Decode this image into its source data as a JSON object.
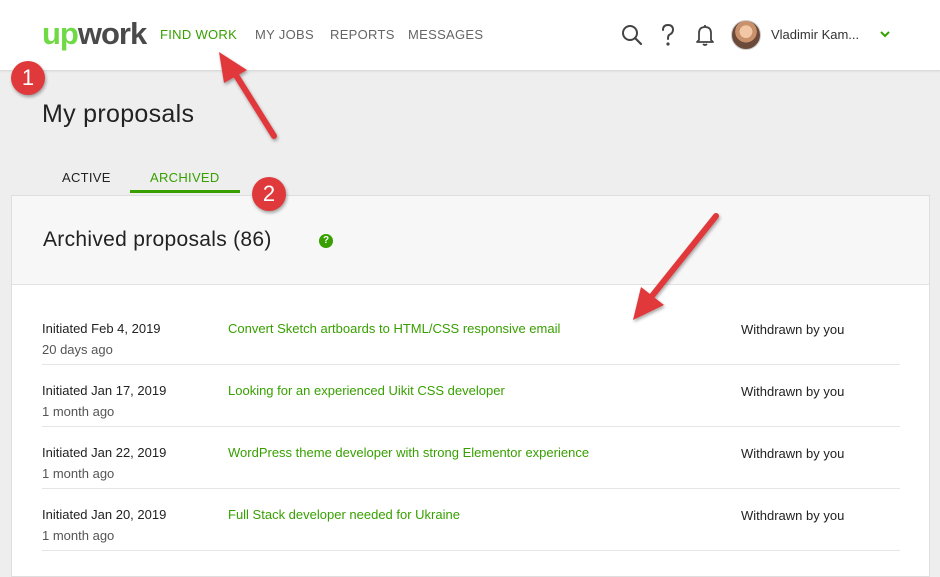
{
  "header": {
    "logo_up": "up",
    "logo_work": "work",
    "nav": [
      {
        "label": "FIND WORK",
        "active": true
      },
      {
        "label": "MY JOBS",
        "active": false
      },
      {
        "label": "REPORTS",
        "active": false
      },
      {
        "label": "MESSAGES",
        "active": false
      }
    ],
    "icons": [
      "search-icon",
      "help-icon",
      "bell-icon"
    ],
    "username": "Vladimir Kam..."
  },
  "page": {
    "title": "My proposals",
    "tabs": [
      {
        "label": "ACTIVE",
        "active": false
      },
      {
        "label": "ARCHIVED",
        "active": true
      }
    ]
  },
  "panel": {
    "title": "Archived proposals (86)",
    "help_glyph": "?",
    "rows": [
      {
        "initiated": "Initiated Feb 4, 2019",
        "ago": "20 days ago",
        "job": "Convert Sketch artboards to HTML/CSS responsive email",
        "status": "Withdrawn by you"
      },
      {
        "initiated": "Initiated Jan 17, 2019",
        "ago": "1 month ago",
        "job": "Looking for an experienced Uikit CSS developer",
        "status": "Withdrawn by you"
      },
      {
        "initiated": "Initiated Jan 22, 2019",
        "ago": "1 month ago",
        "job": "WordPress theme developer with strong Elementor experience",
        "status": "Withdrawn by you"
      },
      {
        "initiated": "Initiated Jan 20, 2019",
        "ago": "1 month ago",
        "job": "Full Stack developer needed for Ukraine",
        "status": "Withdrawn by you"
      }
    ]
  },
  "annotations": {
    "marker1": "1",
    "marker2": "2",
    "color": "#e0393b"
  },
  "colors": {
    "accent": "#37a000",
    "logo_green": "#6fda44"
  }
}
